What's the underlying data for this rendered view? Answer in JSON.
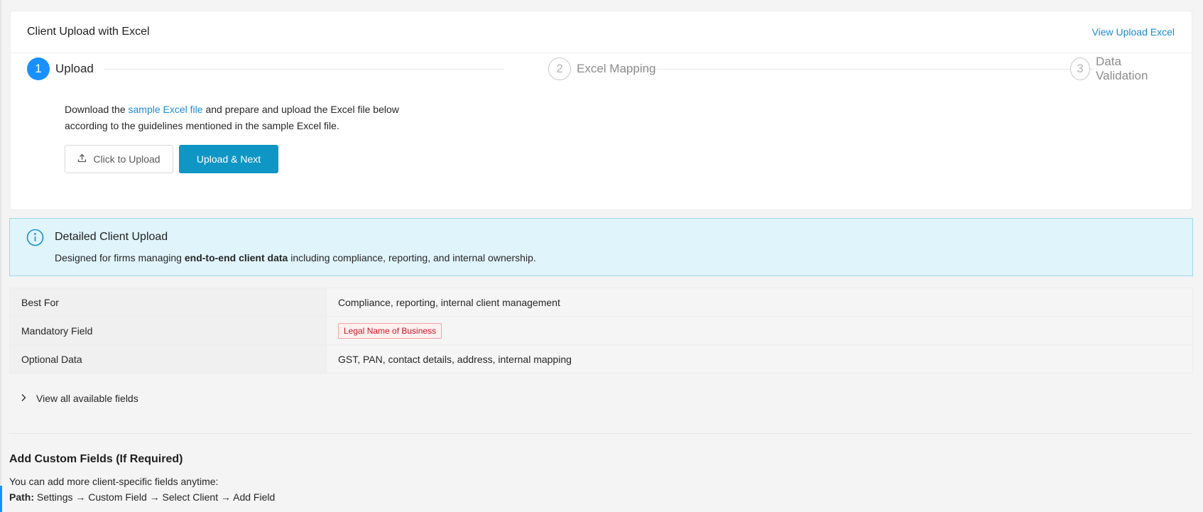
{
  "card": {
    "title": "Client Upload with Excel",
    "view_link": "View Upload Excel"
  },
  "steps": [
    {
      "number": "1",
      "label": "Upload",
      "state": "active"
    },
    {
      "number": "2",
      "label": "Excel Mapping",
      "state": "pending"
    },
    {
      "number": "3",
      "label": "Data Validation",
      "state": "pending"
    }
  ],
  "upload": {
    "desc_prefix": "Download the ",
    "desc_link": "sample Excel file",
    "desc_suffix": " and prepare and upload the Excel file below according to the guidelines mentioned in the sample Excel file.",
    "click_upload_label": "Click to Upload",
    "upload_next_label": "Upload & Next"
  },
  "info": {
    "title": "Detailed Client Upload",
    "text_prefix": "Designed for firms managing ",
    "text_bold": "end-to-end client data",
    "text_suffix": " including compliance, reporting, and internal ownership."
  },
  "table": {
    "rows": [
      {
        "key": "Best For",
        "value": "Compliance, reporting, internal client management"
      },
      {
        "key": "Mandatory Field",
        "value": "Legal Name of Business"
      },
      {
        "key": "Optional Data",
        "value": "GST, PAN, contact details, address, internal mapping"
      }
    ]
  },
  "expander": {
    "label": "View all available fields"
  },
  "custom": {
    "title": "Add Custom Fields (If Required)",
    "text": "You can add more client-specific fields anytime:",
    "path_label": "Path:",
    "path_value": " Settings → Custom Field → Select Client → Add Field"
  },
  "colors": {
    "primary": "#1890ff",
    "button": "#0f96c4",
    "link": "#1a8ad9",
    "info_bg": "#e0f4fb",
    "tag_red": "#cf1322"
  },
  "icons": {
    "upload": "upload-icon",
    "info": "info-circle-icon",
    "expander": "chevron-right-icon"
  }
}
